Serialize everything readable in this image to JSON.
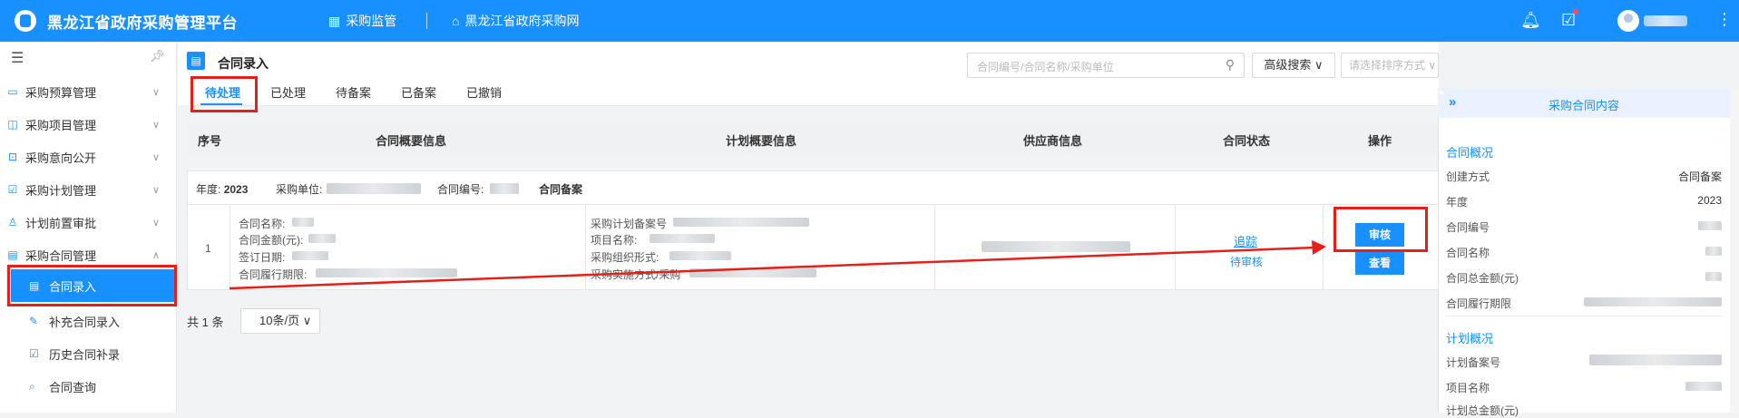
{
  "app": {
    "title": "黑龙江省政府采购管理平台"
  },
  "topnav": [
    {
      "label": "采购监管",
      "icon": "grid-icon"
    },
    {
      "label": "黑龙江省政府采购网",
      "icon": "home-icon"
    }
  ],
  "sidebar": {
    "items": [
      {
        "label": "采购预算管理",
        "icon": "budget-icon"
      },
      {
        "label": "采购项目管理",
        "icon": "project-icon"
      },
      {
        "label": "采购意向公开",
        "icon": "intent-icon"
      },
      {
        "label": "采购计划管理",
        "icon": "plan-icon"
      },
      {
        "label": "计划前置审批",
        "icon": "approval-icon"
      },
      {
        "label": "采购合同管理",
        "icon": "contract-icon"
      }
    ],
    "subitems": [
      {
        "label": "合同录入",
        "icon": "document-icon",
        "active": true
      },
      {
        "label": "补充合同录入",
        "icon": "edit-icon"
      },
      {
        "label": "历史合同补录",
        "icon": "history-icon"
      },
      {
        "label": "合同查询",
        "icon": "query-icon"
      }
    ]
  },
  "page": {
    "title": "合同录入"
  },
  "search": {
    "placeholder": "合同编号/合同名称/采购单位",
    "advanced": "高级搜索",
    "sort_placeholder": "请选择排序方式"
  },
  "tabs": [
    "待处理",
    "已处理",
    "待备案",
    "已备案",
    "已撤销"
  ],
  "table": {
    "headers": [
      "序号",
      "合同概要信息",
      "计划概要信息",
      "供应商信息",
      "合同状态",
      "操作"
    ],
    "group": {
      "year_label": "年度:",
      "year": "2023",
      "unit_label": "采购单位:",
      "code_label": "合同编号:",
      "type": "合同备案"
    },
    "row": {
      "index": "1",
      "contract_fields": [
        "合同名称:",
        "合同金额(元):",
        "签订日期:",
        "合同履行期限:"
      ],
      "plan_fields": [
        "采购计划备案号",
        "项目名称:",
        "采购组织形式:",
        "采购实施方式/采购"
      ],
      "status_link": "追踪",
      "status": "待审核",
      "actions": {
        "review": "审核",
        "view": "查看"
      }
    }
  },
  "pagination": {
    "total": "共 1 条",
    "page_size": "10条/页"
  },
  "panel": {
    "title": "采购合同内容",
    "section1": "合同概况",
    "fields1": [
      {
        "label": "创建方式",
        "value": "合同备案"
      },
      {
        "label": "年度",
        "value": "2023"
      },
      {
        "label": "合同编号",
        "value": ""
      },
      {
        "label": "合同名称",
        "value": ""
      },
      {
        "label": "合同总金额(元)",
        "value": ""
      },
      {
        "label": "合同履行期限",
        "value": ""
      }
    ],
    "section2": "计划概况",
    "fields2": [
      {
        "label": "计划备案号",
        "value": ""
      },
      {
        "label": "项目名称",
        "value": ""
      },
      {
        "label": "计划总金额(元)",
        "value": ""
      }
    ]
  },
  "colors": {
    "primary": "#1890ff",
    "highlight": "#e5201a"
  }
}
